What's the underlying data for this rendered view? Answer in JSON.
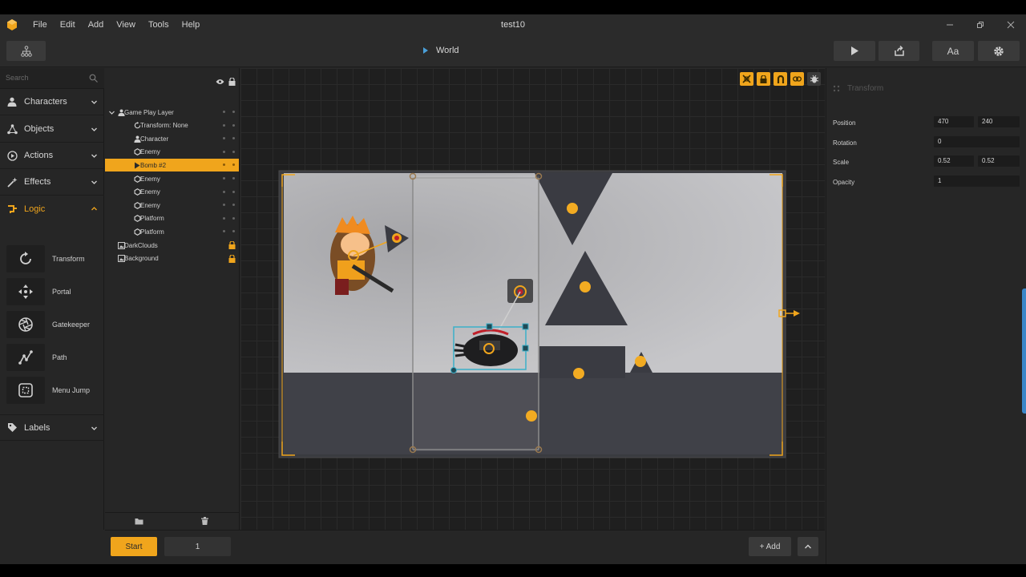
{
  "window": {
    "title": "test10"
  },
  "menu": [
    "File",
    "Edit",
    "Add",
    "View",
    "Tools",
    "Help"
  ],
  "toolbar": {
    "breadcrumb": "World",
    "font_button": "Aa"
  },
  "search": {
    "placeholder": "Search"
  },
  "categories": {
    "characters": "Characters",
    "objects": "Objects",
    "actions": "Actions",
    "effects": "Effects",
    "logic": "Logic",
    "labels": "Labels"
  },
  "logic_items": [
    "Transform",
    "Portal",
    "Gatekeeper",
    "Path",
    "Menu Jump"
  ],
  "layers": [
    {
      "label": "Game Play Layer",
      "icon": "person-icon",
      "indent": 0
    },
    {
      "label": "Transform: None",
      "icon": "rotate-icon",
      "indent": 1
    },
    {
      "label": "Character",
      "icon": "person-icon",
      "indent": 1
    },
    {
      "label": "Enemy",
      "icon": "hexagon-icon",
      "indent": 1
    },
    {
      "label": "Bomb #2",
      "icon": "play-icon",
      "indent": 1,
      "selected": true
    },
    {
      "label": "Enemy",
      "icon": "hexagon-icon",
      "indent": 1
    },
    {
      "label": "Enemy",
      "icon": "hexagon-icon",
      "indent": 1
    },
    {
      "label": "Enemy",
      "icon": "hexagon-icon",
      "indent": 1
    },
    {
      "label": "Platform",
      "icon": "hexagon-icon",
      "indent": 1
    },
    {
      "label": "Platform",
      "icon": "hexagon-icon",
      "indent": 1
    },
    {
      "label": "DarkClouds",
      "icon": "image-icon",
      "indent": 0,
      "locked": true
    },
    {
      "label": "Background",
      "icon": "image-icon",
      "indent": 0,
      "locked": true
    }
  ],
  "properties": {
    "title": "Transform",
    "position_label": "Position",
    "position_x": "470",
    "position_y": "240",
    "rotation_label": "Rotation",
    "rotation": "0",
    "scale_label": "Scale",
    "scale_x": "0.52",
    "scale_y": "0.52",
    "opacity_label": "Opacity",
    "opacity": "1"
  },
  "bottom": {
    "start_label": "Start",
    "frame_value": "1",
    "add_label": "+ Add"
  },
  "colors": {
    "accent": "#f0a51c",
    "selection": "#3bb0c9",
    "panel": "#262626"
  }
}
